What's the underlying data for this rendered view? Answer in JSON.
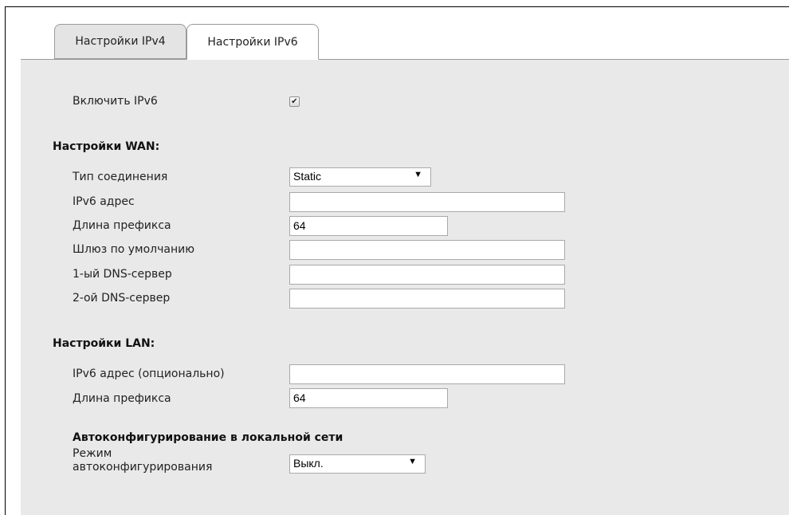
{
  "tabs": [
    {
      "label": "Настройки IPv4",
      "active": false
    },
    {
      "label": "Настройки IPv6",
      "active": true
    }
  ],
  "enable_ipv6": {
    "label": "Включить IPv6",
    "checked": true,
    "check_glyph": "✔"
  },
  "wan": {
    "title": "Настройки WAN:",
    "connection_type": {
      "label": "Тип соединения",
      "value": "Static"
    },
    "ipv6_address": {
      "label": "IPv6 адрес",
      "value": ""
    },
    "prefix_length": {
      "label": "Длина префикса",
      "value": "64"
    },
    "gateway": {
      "label": "Шлюз по умолчанию",
      "value": ""
    },
    "dns1": {
      "label": "1-ый DNS-сервер",
      "value": ""
    },
    "dns2": {
      "label": "2-ой DNS-сервер",
      "value": ""
    }
  },
  "lan": {
    "title": "Настройки LAN:",
    "ipv6_address": {
      "label": "IPv6 адрес (опционально)",
      "value": ""
    },
    "prefix_length": {
      "label": "Длина префикса",
      "value": "64"
    }
  },
  "autoconf": {
    "title": "Автоконфигурирование в локальной сети",
    "mode_label_line1": "Режим",
    "mode_label_line2": "автоконфигурирования",
    "mode_value": "Выкл."
  },
  "icons": {
    "dropdown_arrow": "▼"
  },
  "colors": {
    "panel_bg": "#e9e9e9",
    "tab_inactive_bg": "#e4e4e4"
  }
}
